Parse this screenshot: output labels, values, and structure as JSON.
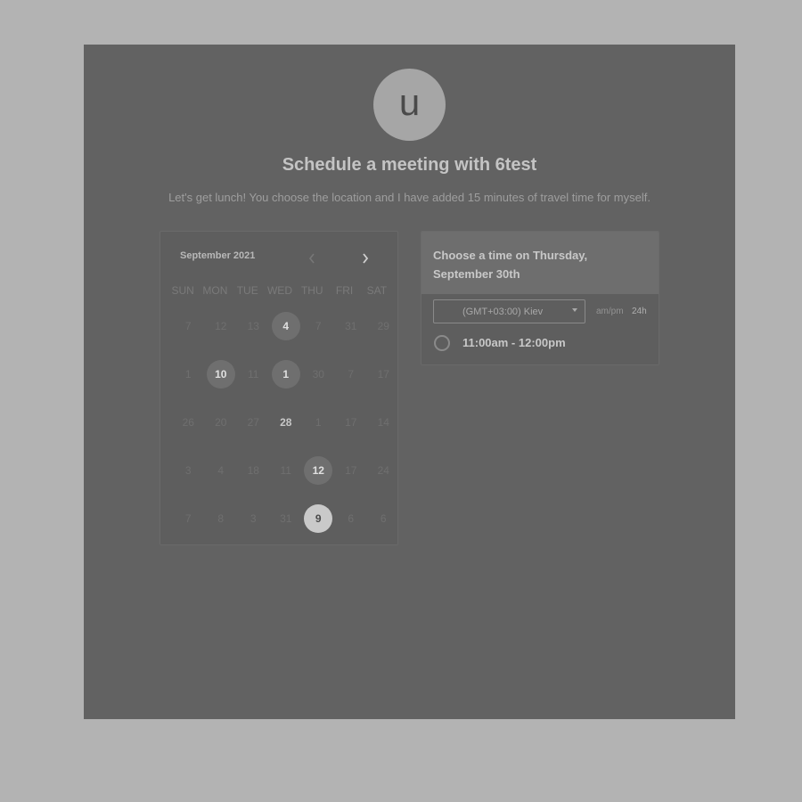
{
  "avatar": {
    "initial": "u"
  },
  "title": "Schedule a meeting with 6test",
  "subtitle": "Let's get lunch! You choose the location and I have added 15 minutes of travel time for myself.",
  "calendar": {
    "month": "September 2021",
    "prev_icon": "chevron-left-icon",
    "next_icon": "chevron-right-icon",
    "weekdays": [
      "SUN",
      "MON",
      "TUE",
      "WED",
      "THU",
      "FRI",
      "SAT"
    ],
    "days": [
      {
        "label": "7",
        "state": "disabled"
      },
      {
        "label": "12",
        "state": "disabled"
      },
      {
        "label": "13",
        "state": "disabled"
      },
      {
        "label": "4",
        "state": "available"
      },
      {
        "label": "7",
        "state": "disabled"
      },
      {
        "label": "31",
        "state": "disabled"
      },
      {
        "label": "29",
        "state": "disabled"
      },
      {
        "label": "1",
        "state": "disabled"
      },
      {
        "label": "10",
        "state": "available"
      },
      {
        "label": "11",
        "state": "disabled"
      },
      {
        "label": "1",
        "state": "available"
      },
      {
        "label": "30",
        "state": "disabled"
      },
      {
        "label": "7",
        "state": "disabled"
      },
      {
        "label": "17",
        "state": "disabled"
      },
      {
        "label": "26",
        "state": "disabled"
      },
      {
        "label": "20",
        "state": "disabled"
      },
      {
        "label": "27",
        "state": "disabled"
      },
      {
        "label": "28",
        "state": "bold"
      },
      {
        "label": "1",
        "state": "disabled"
      },
      {
        "label": "17",
        "state": "disabled"
      },
      {
        "label": "14",
        "state": "disabled"
      },
      {
        "label": "3",
        "state": "disabled"
      },
      {
        "label": "4",
        "state": "disabled"
      },
      {
        "label": "18",
        "state": "disabled"
      },
      {
        "label": "11",
        "state": "disabled"
      },
      {
        "label": "12",
        "state": "available"
      },
      {
        "label": "17",
        "state": "disabled"
      },
      {
        "label": "24",
        "state": "disabled"
      },
      {
        "label": "7",
        "state": "disabled"
      },
      {
        "label": "8",
        "state": "disabled"
      },
      {
        "label": "3",
        "state": "disabled"
      },
      {
        "label": "31",
        "state": "disabled"
      },
      {
        "label": "9",
        "state": "selected"
      },
      {
        "label": "6",
        "state": "disabled"
      },
      {
        "label": "6",
        "state": "disabled"
      }
    ]
  },
  "times": {
    "header": "Choose a time on Thursday, September 30th",
    "timezone": "(GMT+03:00) Kiev",
    "format_ampm": "am/pm",
    "format_24h": "24h",
    "slots": [
      {
        "label": "11:00am - 12:00pm"
      }
    ]
  },
  "colors": {
    "page_bg": "#b3b3b3",
    "card_bg": "#626262",
    "selected_day": "#c9c9c9"
  }
}
